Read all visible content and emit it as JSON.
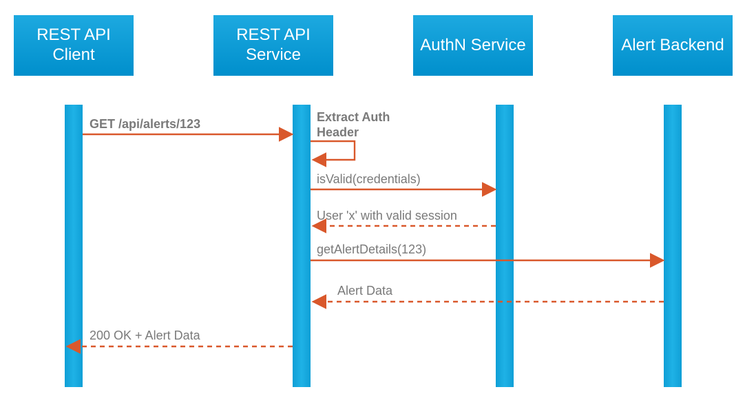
{
  "actors": {
    "client": {
      "label": "REST API\nClient"
    },
    "service": {
      "label": "REST API\nService"
    },
    "authn": {
      "label": "AuthN\nService"
    },
    "backend": {
      "label": "Alert\nBackend"
    }
  },
  "messages": {
    "m1": "GET /api/alerts/123",
    "m2": "Extract Auth\nHeader",
    "m3": "isValid(credentials)",
    "m4": "User 'x' with valid session",
    "m5": "getAlertDetails(123)",
    "m6": "Alert Data",
    "m7": "200 OK + Alert Data"
  },
  "colors": {
    "arrow": "#d9582b",
    "text": "#7a7a7a",
    "box": "#0f9fd6"
  },
  "diagram": {
    "type": "sequence",
    "participants": [
      "REST API Client",
      "REST API Service",
      "AuthN Service",
      "Alert Backend"
    ],
    "interactions": [
      {
        "from": "REST API Client",
        "to": "REST API Service",
        "label": "GET /api/alerts/123",
        "style": "solid",
        "kind": "request"
      },
      {
        "from": "REST API Service",
        "to": "REST API Service",
        "label": "Extract Auth Header",
        "style": "solid",
        "kind": "self"
      },
      {
        "from": "REST API Service",
        "to": "AuthN Service",
        "label": "isValid(credentials)",
        "style": "solid",
        "kind": "request"
      },
      {
        "from": "AuthN Service",
        "to": "REST API Service",
        "label": "User 'x' with valid session",
        "style": "dashed",
        "kind": "response"
      },
      {
        "from": "REST API Service",
        "to": "Alert Backend",
        "label": "getAlertDetails(123)",
        "style": "solid",
        "kind": "request"
      },
      {
        "from": "Alert Backend",
        "to": "REST API Service",
        "label": "Alert Data",
        "style": "dashed",
        "kind": "response"
      },
      {
        "from": "REST API Service",
        "to": "REST API Client",
        "label": "200 OK + Alert Data",
        "style": "dashed",
        "kind": "response"
      }
    ]
  }
}
